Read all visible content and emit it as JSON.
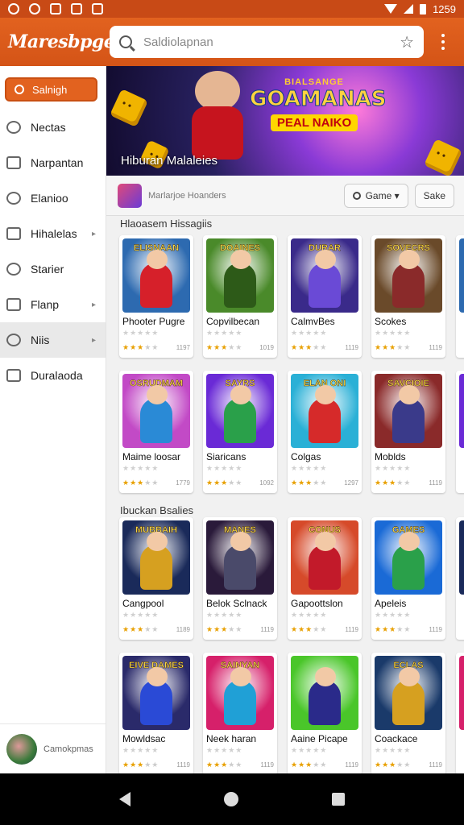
{
  "status_bar": {
    "time": "1259"
  },
  "app": {
    "title": "Maresbpge"
  },
  "search": {
    "placeholder": "Saldiolapnan"
  },
  "sidebar": {
    "primary_button": "Salnigh",
    "items": [
      {
        "label": "Nectas",
        "icon": "compass-icon",
        "has_chevron": false
      },
      {
        "label": "Narpantan",
        "icon": "image-icon",
        "has_chevron": false
      },
      {
        "label": "Elanioo",
        "icon": "calendar-icon",
        "has_chevron": false
      },
      {
        "label": "Hihalelas",
        "icon": "grid-icon",
        "has_chevron": true
      },
      {
        "label": "Starier",
        "icon": "tag-icon",
        "has_chevron": false
      },
      {
        "label": "Flanp",
        "icon": "circle-icon",
        "has_chevron": true
      },
      {
        "label": "Niis",
        "icon": "close-box-icon",
        "has_chevron": true,
        "active": true
      },
      {
        "label": "Duralaoda",
        "icon": "download-icon",
        "has_chevron": false
      }
    ],
    "footer_label": "Camokpmas"
  },
  "banner": {
    "top_text": "BIALSANGE",
    "main_text": "GOAMANAS",
    "sub_text": "PEAL NAIKO",
    "caption": "Hiburan Malaleies"
  },
  "filter_bar": {
    "label": "Marlarjoe Hoanders",
    "game_chip": "Game ▾",
    "sake_chip": "Sake"
  },
  "sections": [
    {
      "title": "Hlaoasem Hissagiis",
      "rows": [
        [
          {
            "name": "Phooter Pugre",
            "tag": "ELISNAAN",
            "count": "1197",
            "rating": 3,
            "bg": "#2d6ab0",
            "hero": "#d6202a"
          },
          {
            "name": "Copvilbecan",
            "tag": "DOAINES",
            "count": "1019",
            "rating": 3,
            "bg": "#4a8a2a",
            "hero": "#2d5a18"
          },
          {
            "name": "CalmvBes",
            "tag": "DURAR",
            "count": "1119",
            "rating": 3,
            "bg": "#3a2a8a",
            "hero": "#6a4ad6"
          },
          {
            "name": "Scokes",
            "tag": "SOVECRS",
            "count": "1119",
            "rating": 3,
            "bg": "#6a4a2a",
            "hero": "#8a2a2a"
          }
        ],
        [
          {
            "name": "Maime loosar",
            "tag": "OSRUDMAM",
            "count": "1779",
            "rating": 3,
            "bg": "#c24ac6",
            "hero": "#2a8ad6"
          },
          {
            "name": "Siaricans",
            "tag": "SAYRS",
            "count": "1092",
            "rating": 3,
            "bg": "#6a2ad6",
            "hero": "#2aa04a"
          },
          {
            "name": "Colgas",
            "tag": "ELAN ONI",
            "count": "1297",
            "rating": 3,
            "bg": "#2ab0d6",
            "hero": "#d62a2a"
          },
          {
            "name": "Moblds",
            "tag": "SAVCIOIE",
            "count": "1119",
            "rating": 3,
            "bg": "#8a2a2a",
            "hero": "#3a3a8a"
          }
        ]
      ]
    },
    {
      "title": "Ibuckan Bsalies",
      "rows": [
        [
          {
            "name": "Cangpool",
            "tag": "MUBBAIH",
            "count": "1189",
            "rating": 3,
            "bg": "#1a2a5a",
            "hero": "#d6a020"
          },
          {
            "name": "Belok Sclnack",
            "tag": "MANES",
            "count": "1119",
            "rating": 3,
            "bg": "#2a1a3a",
            "hero": "#4a4a6a"
          },
          {
            "name": "Gapoottslon",
            "tag": "CONUS",
            "count": "1119",
            "rating": 3,
            "bg": "#d64a2a",
            "hero": "#c21a2a"
          },
          {
            "name": "Apeleis",
            "tag": "GAMES",
            "count": "1119",
            "rating": 3,
            "bg": "#1a6ad6",
            "hero": "#2aa04a"
          }
        ],
        [
          {
            "name": "Mowldsac",
            "tag": "EIVE DAMES",
            "count": "1119",
            "rating": 3,
            "bg": "#2a2a6a",
            "hero": "#2a4ad6"
          },
          {
            "name": "Neek haran",
            "tag": "SAINYAN",
            "count": "1119",
            "rating": 3,
            "bg": "#d6206a",
            "hero": "#20a0d6"
          },
          {
            "name": "Aaine Picape",
            "tag": "",
            "count": "1119",
            "rating": 3,
            "bg": "#4ac62a",
            "hero": "#2a2a8a"
          },
          {
            "name": "Coackace",
            "tag": "ECLAS",
            "count": "1119",
            "rating": 3,
            "bg": "#1a3a6a",
            "hero": "#d6a020"
          }
        ]
      ]
    }
  ],
  "colors": {
    "brand": "#e2621f",
    "star": "#e8a000"
  }
}
